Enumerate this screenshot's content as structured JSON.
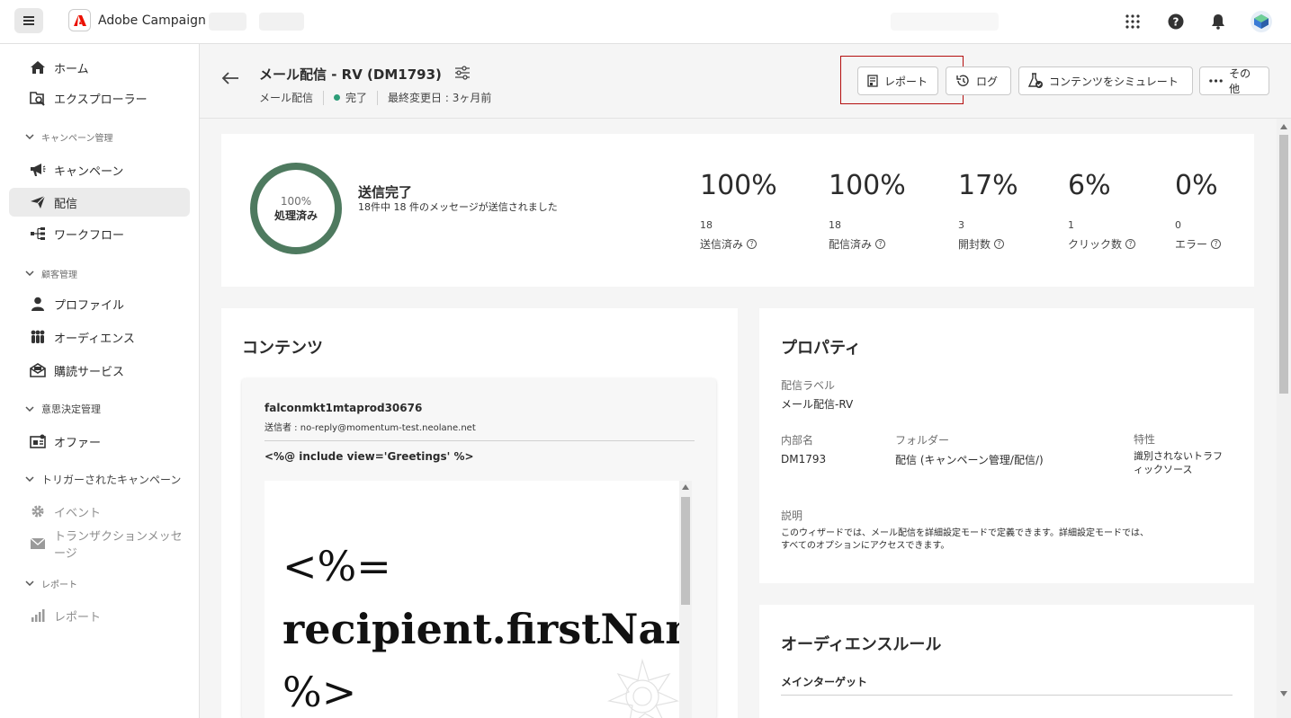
{
  "app": {
    "name": "Adobe Campaign",
    "accent": "#eb1000"
  },
  "sidebar": {
    "items": [
      {
        "label": "ホーム",
        "icon": "home-icon"
      },
      {
        "label": "エクスプローラー",
        "icon": "explorer-icon"
      },
      {
        "label": "キャンペーン",
        "icon": "megaphone-icon"
      },
      {
        "label": "配信",
        "icon": "send-icon"
      },
      {
        "label": "ワークフロー",
        "icon": "workflow-icon"
      },
      {
        "label": "プロファイル",
        "icon": "user-icon"
      },
      {
        "label": "オーディエンス",
        "icon": "audience-icon"
      },
      {
        "label": "購読サービス",
        "icon": "subscription-icon"
      },
      {
        "label": "オファー",
        "icon": "offer-icon"
      },
      {
        "label": "イベント",
        "icon": "gear-icon"
      },
      {
        "label": "トランザクションメッセージ",
        "icon": "mail-icon"
      },
      {
        "label": "レポート",
        "icon": "chart-icon"
      }
    ],
    "sections": {
      "campaign_mgmt": "キャンペーン管理",
      "customer_mgmt": "顧客管理",
      "decision_mgmt": "意思決定管理",
      "triggered": "トリガーされたキャンペーン",
      "reports": "レポート"
    }
  },
  "header": {
    "title": "メール配信 - RV (DM1793)",
    "type": "メール配信",
    "status": "完了",
    "modified": "最終変更日 : 3ヶ月前",
    "buttons": {
      "report": "レポート",
      "log": "ログ",
      "simulate": "コンテンツをシミュレート",
      "more": "その他"
    }
  },
  "summary": {
    "circle_pct": "100%",
    "circle_label": "処理済み",
    "title": "送信完了",
    "subtitle": "18件中 18 件のメッセージが送信されました",
    "stats": [
      {
        "value": "100%",
        "count": "18",
        "name": "送信済み"
      },
      {
        "value": "100%",
        "count": "18",
        "name": "配信済み"
      },
      {
        "value": "17%",
        "count": "3",
        "name": "開封数"
      },
      {
        "value": "6%",
        "count": "1",
        "name": "クリック数"
      },
      {
        "value": "0%",
        "count": "0",
        "name": "エラー"
      }
    ]
  },
  "content": {
    "title": "コンテンツ",
    "from_name": "falconmkt1mtaprod30676",
    "from": "送信者 : no-reply@momentum-test.neolane.net",
    "subject": "<%@ include view='Greetings' %>",
    "preview_line1": "<%=",
    "preview_line2": "recipient.firstNam",
    "preview_line3": "%>"
  },
  "properties": {
    "title": "プロパティ",
    "label_title": "配信ラベル",
    "label_value": "メール配信-RV",
    "internal_title": "内部名",
    "internal_value": "DM1793",
    "folder_title": "フォルダー",
    "folder_value": "配信 (キャンペーン管理/配信/)",
    "nature_title": "特性",
    "nature_value_1": "識別されないトラフ",
    "nature_value_2": "ィックソース",
    "desc_title": "説明",
    "desc_value_1": "このウィザードでは、メール配信を詳細設定モードで定義できます。詳細設定モードでは、",
    "desc_value_2": "すべてのオプションにアクセスできます。"
  },
  "audience": {
    "title": "オーディエンスルール",
    "main_target": "メインターゲット"
  }
}
